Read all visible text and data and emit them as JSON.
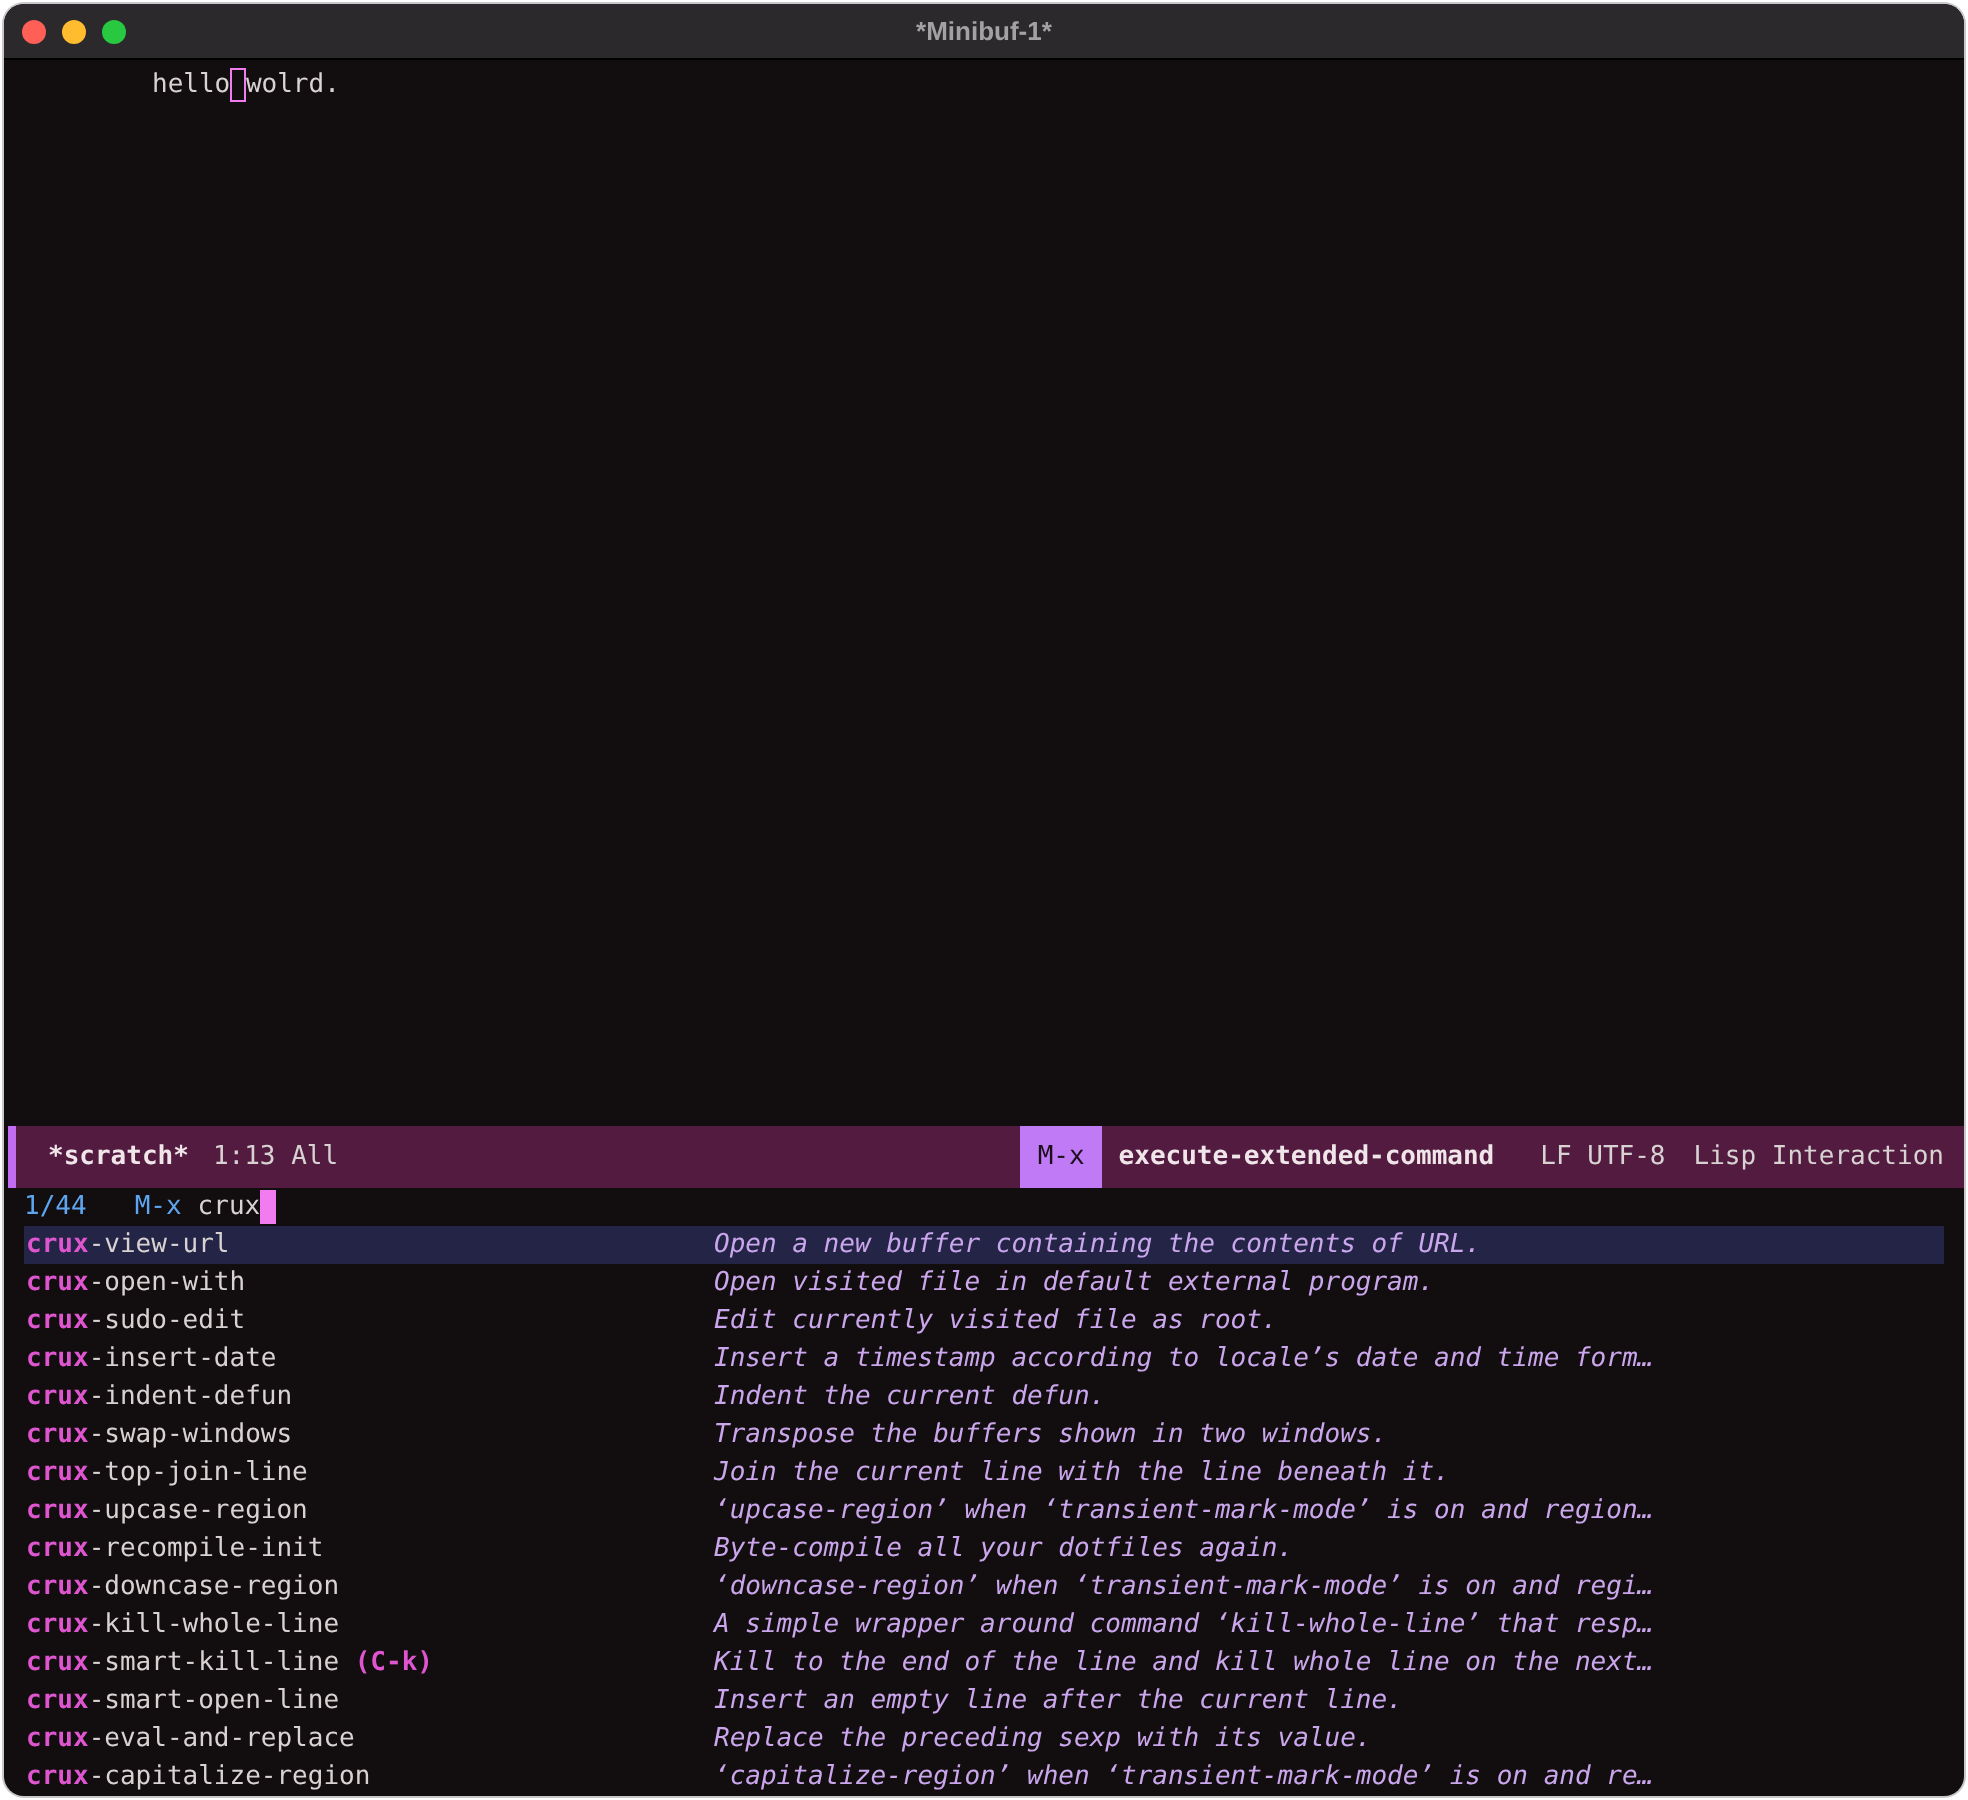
{
  "window": {
    "title": "*Minibuf-1*"
  },
  "buffer": {
    "text_before_cursor": "hello",
    "text_after_cursor": "wolrd.",
    "cursor_filled": false
  },
  "mode_line": {
    "buffer_name": "*scratch*",
    "position": "1:13 All",
    "key": "M-x",
    "command": "execute-extended-command",
    "encoding": "LF UTF-8",
    "major_mode": "Lisp Interaction"
  },
  "minibuffer": {
    "count": "1/44",
    "prompt": "M-x",
    "input": "crux",
    "cursor_filled": true
  },
  "candidates": [
    {
      "match": "crux",
      "rest": "-view-url",
      "description": "Open a new buffer containing the contents of URL.",
      "selected": true
    },
    {
      "match": "crux",
      "rest": "-open-with",
      "description": "Open visited file in default external program.",
      "selected": false
    },
    {
      "match": "crux",
      "rest": "-sudo-edit",
      "description": "Edit currently visited file as root.",
      "selected": false
    },
    {
      "match": "crux",
      "rest": "-insert-date",
      "description": "Insert a timestamp according to locale’s date and time form…",
      "selected": false
    },
    {
      "match": "crux",
      "rest": "-indent-defun",
      "description": "Indent the current defun.",
      "selected": false
    },
    {
      "match": "crux",
      "rest": "-swap-windows",
      "description": "Transpose the buffers shown in two windows.",
      "selected": false
    },
    {
      "match": "crux",
      "rest": "-top-join-line",
      "description": "Join the current line with the line beneath it.",
      "selected": false
    },
    {
      "match": "crux",
      "rest": "-upcase-region",
      "description": "‘upcase-region’ when ‘transient-mark-mode’ is on and region…",
      "selected": false
    },
    {
      "match": "crux",
      "rest": "-recompile-init",
      "description": "Byte-compile all your dotfiles again.",
      "selected": false
    },
    {
      "match": "crux",
      "rest": "-downcase-region",
      "description": "‘downcase-region’ when ‘transient-mark-mode’ is on and regi…",
      "selected": false
    },
    {
      "match": "crux",
      "rest": "-kill-whole-line",
      "description": "A simple wrapper around command ‘kill-whole-line’ that resp…",
      "selected": false
    },
    {
      "match": "crux",
      "rest": "-smart-kill-line",
      "keybinding": "(C-k)",
      "description": "Kill to the end of the line and kill whole line on the next…",
      "selected": false
    },
    {
      "match": "crux",
      "rest": "-smart-open-line",
      "description": "Insert an empty line after the current line.",
      "selected": false
    },
    {
      "match": "crux",
      "rest": "-eval-and-replace",
      "description": "Replace the preceding sexp with its value.",
      "selected": false
    },
    {
      "match": "crux",
      "rest": "-capitalize-region",
      "description": "‘capitalize-region’ when ‘transient-mark-mode’ is on and re…",
      "selected": false
    }
  ]
}
